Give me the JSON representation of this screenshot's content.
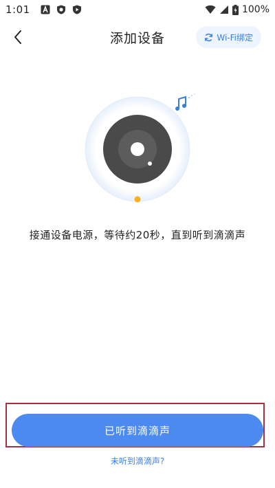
{
  "status_bar": {
    "time": "1:01",
    "battery": "100%"
  },
  "header": {
    "title": "添加设备",
    "wifi_bind_label": "Wi-Fi绑定"
  },
  "main": {
    "instruction": "接通设备电源，等待约20秒，直到听到滴滴声"
  },
  "footer": {
    "confirm_label": "已听到滴滴声",
    "not_heard_label": "未听到滴滴声?"
  },
  "colors": {
    "accent": "#4d8af0",
    "link": "#3b7fdd",
    "indicator": "#f5b21d",
    "device": "#4a4a4a"
  },
  "icons": {
    "back": "chevron-left-icon",
    "wifi_bind": "refresh-icon",
    "note": "music-note-icon"
  }
}
